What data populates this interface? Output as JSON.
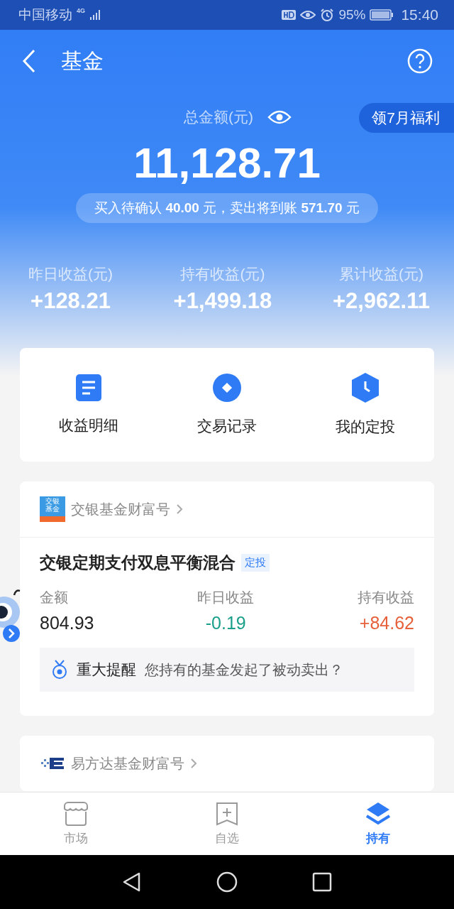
{
  "status_bar": {
    "carrier": "中国移动",
    "network": "4G",
    "battery": "95%",
    "time": "15:40"
  },
  "header": {
    "title": "基金"
  },
  "summary": {
    "label": "总金额(元)",
    "promo": "领7月福利",
    "total": "11,128.71",
    "pending": "买入待确认 **40.00** 元，卖出将到账 **571.70** 元"
  },
  "stats": [
    {
      "label": "昨日收益(元)",
      "value": "+128.21"
    },
    {
      "label": "持有收益(元)",
      "value": "+1,499.18"
    },
    {
      "label": "累计收益(元)",
      "value": "+2,962.11"
    }
  ],
  "shortcuts": [
    {
      "label": "收益明细",
      "kind": "document"
    },
    {
      "label": "交易记录",
      "kind": "record"
    },
    {
      "label": "我的定投",
      "kind": "clock"
    }
  ],
  "holdings": [
    {
      "company": "交银基金财富号",
      "kind": "jiaoyin",
      "logo_text": [
        "交银",
        "基金"
      ],
      "fund": {
        "name": "交银定期支付双息平衡混合",
        "tag": "定投",
        "columns": [
          {
            "label": "金额",
            "value": "804.93",
            "kind": "flat"
          },
          {
            "label": "昨日收益",
            "value": "-0.19",
            "kind": "down"
          },
          {
            "label": "持有收益",
            "value": "+84.62",
            "kind": "up"
          }
        ],
        "notice": {
          "title": "重大提醒",
          "text": "您持有的基金发起了被动卖出？"
        }
      }
    },
    {
      "company": "易方达基金财富号",
      "kind": "efunds"
    }
  ],
  "tabs": [
    {
      "label": "市场",
      "kind": "market",
      "selected": false
    },
    {
      "label": "自选",
      "kind": "watchlist",
      "selected": false
    },
    {
      "label": "持有",
      "kind": "holdings",
      "selected": true
    }
  ]
}
